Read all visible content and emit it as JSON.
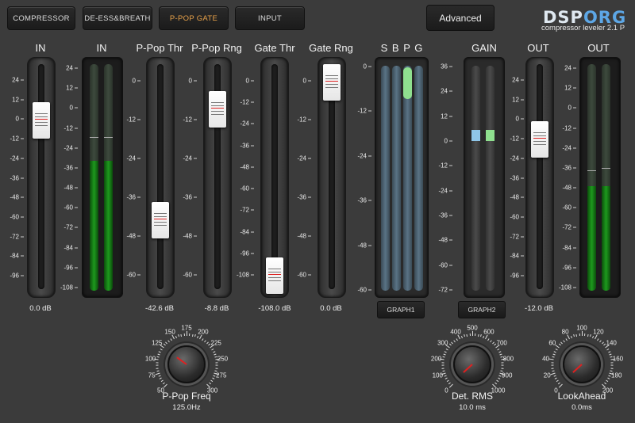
{
  "tabs": [
    "COMPRESSOR",
    "DE-ESS&BREATH",
    "P-POP GATE",
    "INPUT"
  ],
  "active_tab": "P-POP GATE",
  "advanced_label": "Advanced",
  "logo": {
    "part1": "DSP",
    "part2": "ORG",
    "subtitle": "compressor leveler 2.1 P"
  },
  "channels": {
    "in_slider": {
      "label": "IN",
      "value": "0.0 dB",
      "scale": [
        "24",
        "12",
        "0",
        "-12",
        "-24",
        "-36",
        "-48",
        "-60",
        "-72",
        "-84",
        "-96"
      ]
    },
    "in_meter": {
      "label": "IN",
      "scale": [
        "24",
        "12",
        "0",
        "-12",
        "-24",
        "-36",
        "-48",
        "-60",
        "-72",
        "-84",
        "-96",
        "-108"
      ]
    },
    "ppop_thr": {
      "label": "P-Pop Thr",
      "value": "-42.6 dB",
      "scale": [
        "0",
        "-12",
        "-24",
        "-36",
        "-48",
        "-60"
      ]
    },
    "ppop_rng": {
      "label": "P-Pop Rng",
      "value": "-8.8 dB",
      "scale": [
        "0",
        "-12",
        "-24",
        "-36",
        "-48",
        "-60"
      ]
    },
    "gate_thr": {
      "label": "Gate Thr",
      "value": "-108.0 dB",
      "scale": [
        "0",
        "-12",
        "-24",
        "-36",
        "-48",
        "-60",
        "-72",
        "-84",
        "-96",
        "-108"
      ]
    },
    "gate_rng": {
      "label": "Gate Rng",
      "value": "0.0 dB",
      "scale": [
        "0",
        "-12",
        "-24",
        "-36",
        "-48",
        "-60"
      ]
    },
    "sbpg": {
      "label": "S B P G",
      "scale": [
        "0",
        "-12",
        "-24",
        "-36",
        "-48",
        "-60"
      ],
      "graph_button": "GRAPH1"
    },
    "gain": {
      "label": "GAIN",
      "scale": [
        "36",
        "24",
        "12",
        "0",
        "-12",
        "-24",
        "-36",
        "-48",
        "-60",
        "-72"
      ],
      "graph_button": "GRAPH2"
    },
    "out_slider": {
      "label": "OUT",
      "value": "-12.0 dB",
      "scale": [
        "24",
        "12",
        "0",
        "-12",
        "-24",
        "-36",
        "-48",
        "-60",
        "-72",
        "-84",
        "-96"
      ]
    },
    "out_meter": {
      "label": "OUT",
      "scale": [
        "24",
        "12",
        "0",
        "-12",
        "-24",
        "-36",
        "-48",
        "-60",
        "-72",
        "-84",
        "-96",
        "-108"
      ]
    }
  },
  "knobs": {
    "ppop_freq": {
      "label": "P-Pop Freq",
      "value": "125.0Hz",
      "scale": [
        "50",
        "75",
        "100",
        "125",
        "150",
        "175",
        "200",
        "225",
        "250",
        "275",
        "300"
      ]
    },
    "det_rms": {
      "label": "Det. RMS",
      "value": "10.0 ms",
      "scale": [
        "0",
        "100",
        "200",
        "300",
        "400",
        "500",
        "600",
        "700",
        "800",
        "900",
        "1000"
      ]
    },
    "lookahead": {
      "label": "LookAhead",
      "value": "0.0ms",
      "scale": [
        "0",
        "20",
        "40",
        "60",
        "80",
        "100",
        "120",
        "140",
        "160",
        "180",
        "200"
      ]
    }
  },
  "colors": {
    "accent": "#e8a24a",
    "meter_green": "#1e9a1e",
    "logo_blue": "#5da7e6",
    "gain_blue": "#8fc6e8",
    "gain_green": "#8fe08f"
  }
}
